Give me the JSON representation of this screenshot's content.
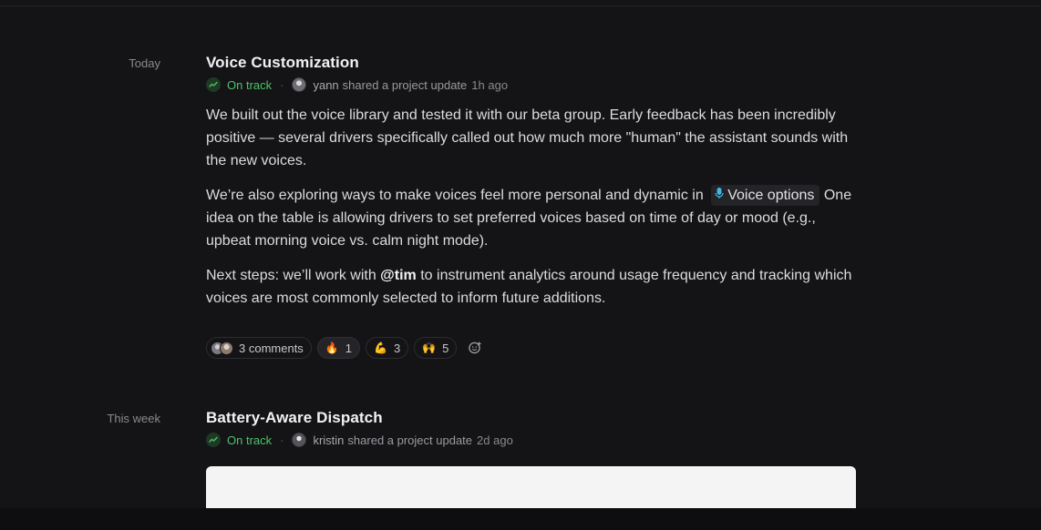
{
  "updates": [
    {
      "date_label": "Today",
      "title": "Voice Customization",
      "status": "On track",
      "author": "yann",
      "action": "shared a project update",
      "time": "1h ago",
      "paragraphs": {
        "p1": "We built out the voice library and tested it with our beta group. Early feedback has been incredibly positive — several drivers specifically called out how much more \"human\" the assistant sounds with the new voices.",
        "p2_before": "We’re also exploring ways to make voices feel more personal and dynamic in",
        "p2_chip": "Voice options",
        "p2_after": "One idea on the table is allowing drivers to set preferred voices based on time of day or mood (e.g., upbeat morning voice vs. calm night mode).",
        "p3_before": "Next steps: we’ll work with",
        "p3_mention": "@tim",
        "p3_after": "to instrument analytics around usage frequency and tracking which voices are most commonly selected to inform future additions."
      },
      "comments_label": "3 comments",
      "reactions": [
        {
          "emoji": "🔥",
          "count": "1"
        },
        {
          "emoji": "💪",
          "count": "3"
        },
        {
          "emoji": "🙌",
          "count": "5"
        }
      ]
    },
    {
      "date_label": "This week",
      "title": "Battery-Aware Dispatch",
      "status": "On track",
      "author": "kristin",
      "action": "shared a project update",
      "time": "2d ago"
    }
  ],
  "colors": {
    "background": "#141416",
    "status_green": "#4cc36a",
    "text": "#dcdce0",
    "mic_accent": "#3fb6e0"
  },
  "icons": {
    "status": "trend-up-icon",
    "chip": "microphone-icon",
    "add_reaction": "add-reaction-icon"
  }
}
